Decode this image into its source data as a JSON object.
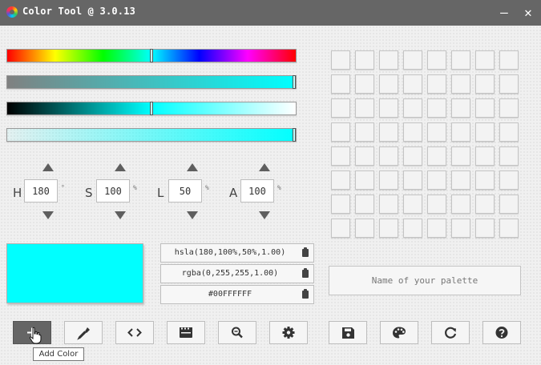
{
  "window": {
    "title": "Color Tool @ 3.0.13",
    "minimize_glyph": "—",
    "close_glyph": "✕"
  },
  "sliders": [
    {
      "name": "hue-slider",
      "value": 180,
      "max": 360
    },
    {
      "name": "saturation-slider",
      "value": 100,
      "max": 100
    },
    {
      "name": "lightness-slider",
      "value": 50,
      "max": 100
    },
    {
      "name": "alpha-slider",
      "value": 1.0,
      "max": 1.0
    }
  ],
  "channels": [
    {
      "label": "H",
      "value": "180",
      "unit": "°"
    },
    {
      "label": "S",
      "value": "100",
      "unit": "%"
    },
    {
      "label": "L",
      "value": "50",
      "unit": "%"
    },
    {
      "label": "A",
      "value": "100",
      "unit": "%"
    }
  ],
  "preview": {
    "color": "#00ffff"
  },
  "codes": {
    "hsla": "hsla(180,100%,50%,1.00)",
    "rgba": "rgba(0,255,255,1.00)",
    "hex": "#00FFFFFF"
  },
  "palette": {
    "rows": 8,
    "cols": 8,
    "name_placeholder": "Name of your palette"
  },
  "toolbar": {
    "buttons": [
      {
        "name": "add-color-button",
        "icon": "plus-icon",
        "active": true
      },
      {
        "name": "eyedropper-button",
        "icon": "eyedropper-icon"
      },
      {
        "name": "code-button",
        "icon": "code-icon"
      },
      {
        "name": "palette-list-button",
        "icon": "clapperboard-icon"
      },
      {
        "name": "zoom-button",
        "icon": "magnifier-icon"
      },
      {
        "name": "settings-button",
        "icon": "gear-icon"
      },
      {
        "name": "save-button",
        "icon": "floppy-disk-icon"
      },
      {
        "name": "theme-button",
        "icon": "palette-icon"
      },
      {
        "name": "refresh-button",
        "icon": "refresh-icon"
      },
      {
        "name": "help-button",
        "icon": "help-icon"
      }
    ],
    "tooltip": "Add Color"
  }
}
